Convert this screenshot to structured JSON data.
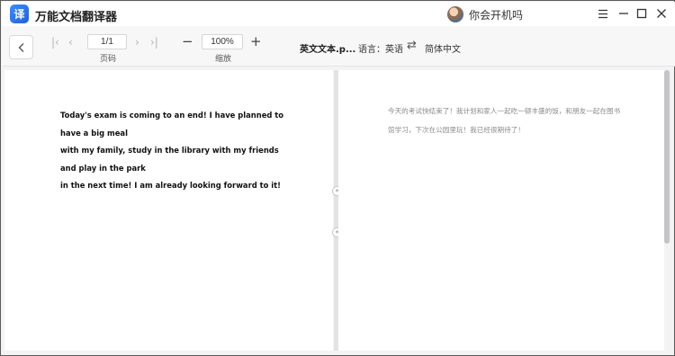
{
  "app": {
    "title": "万能文档翻译器",
    "icon_glyph": "译",
    "brand_color": "#2f7cf6"
  },
  "user": {
    "name": "你会开机吗"
  },
  "window_controls": {
    "menu": "menu-icon",
    "minimize": "minimize-icon",
    "maximize": "maximize-icon",
    "close": "close-icon"
  },
  "toolbar": {
    "page": {
      "value": "1/1",
      "caption": "页码"
    },
    "zoom": {
      "value": "100%",
      "caption": "缩放",
      "minus": "−",
      "plus": "+"
    },
    "file_name": "英文文本.p...",
    "language_label": "语言：英语",
    "target_language": "简体中文"
  },
  "document": {
    "source_lines": [
      "Today's exam is coming to an end! I have planned to have a big meal",
      "with my family, study in the library with my friends and play in the park",
      "in the next time! I am already looking forward to it!"
    ],
    "translation_lines": [
      "今天的考试快结束了！我计划和家人一起吃一顿丰盛的饭，和朋友一起在图书",
      "馆学习，下次在公园里玩！我已经很期待了！"
    ]
  }
}
